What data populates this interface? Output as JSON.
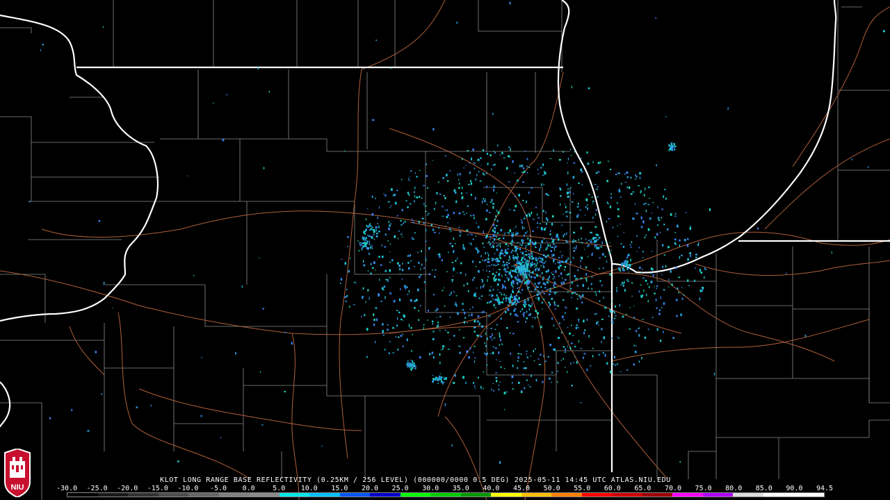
{
  "header": {
    "title": "KLOT LONG RANGE BASE REFLECTIVITY (0.25KM / 256 LEVEL) (000000/0000 0.5 DEG) 2025-05-11 14:45 UTC  ATLAS.NIU.EDU"
  },
  "legend": {
    "ticks": [
      "-30.0",
      "-25.0",
      "-20.0",
      "-15.0",
      "-10.0",
      "-5.0",
      "0.0",
      "5.0",
      "10.0",
      "15.0",
      "20.0",
      "25.0",
      "30.0",
      "35.0",
      "40.0",
      "45.0",
      "50.0",
      "55.0",
      "60.0",
      "65.0",
      "70.0",
      "75.0",
      "80.0",
      "85.0",
      "90.0",
      "94.5"
    ],
    "colors": [
      "#000000",
      "#1a1a1a",
      "#333333",
      "#4d4d4d",
      "#666666",
      "#808080",
      "#8a8a8a",
      "#00e6e6",
      "#00bfff",
      "#0055ff",
      "#0000cc",
      "#00ff00",
      "#00cc00",
      "#009900",
      "#ffff00",
      "#ffc000",
      "#ff8000",
      "#ff0000",
      "#d00000",
      "#a00000",
      "#ff00ff",
      "#b000ff",
      "#dddddd",
      "#ffffff",
      "#ffffff"
    ]
  },
  "logo": {
    "text": "NIU"
  },
  "colors": {
    "state_border": "#ffffff",
    "county_border": "#8c8c8c",
    "highway": "#b0603a",
    "echo_primary": "#28a0e0",
    "echo_secondary": "#1ec8d8"
  }
}
